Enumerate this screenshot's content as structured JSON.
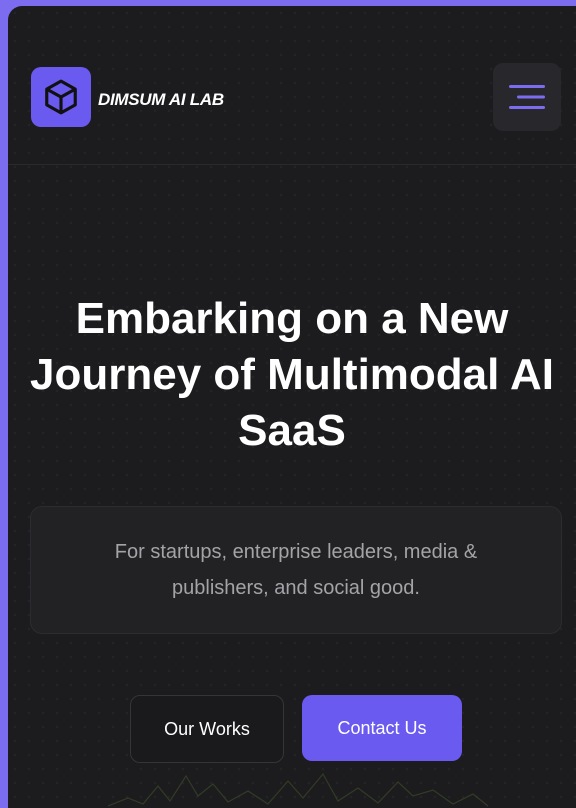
{
  "header": {
    "brand": "DIMSUM AI LAB",
    "logo_icon": "cube-icon",
    "menu_icon": "hamburger-menu-icon"
  },
  "hero": {
    "title": "Embarking on a New Journey of Multimodal AI SaaS",
    "subtitle": "For startups, enterprise leaders, media & publishers, and social good."
  },
  "actions": {
    "works_label": "Our Works",
    "contact_label": "Contact Us"
  },
  "colors": {
    "accent": "#6a5af0",
    "background": "#1c1c1e",
    "outer": "#7b6cf0"
  }
}
